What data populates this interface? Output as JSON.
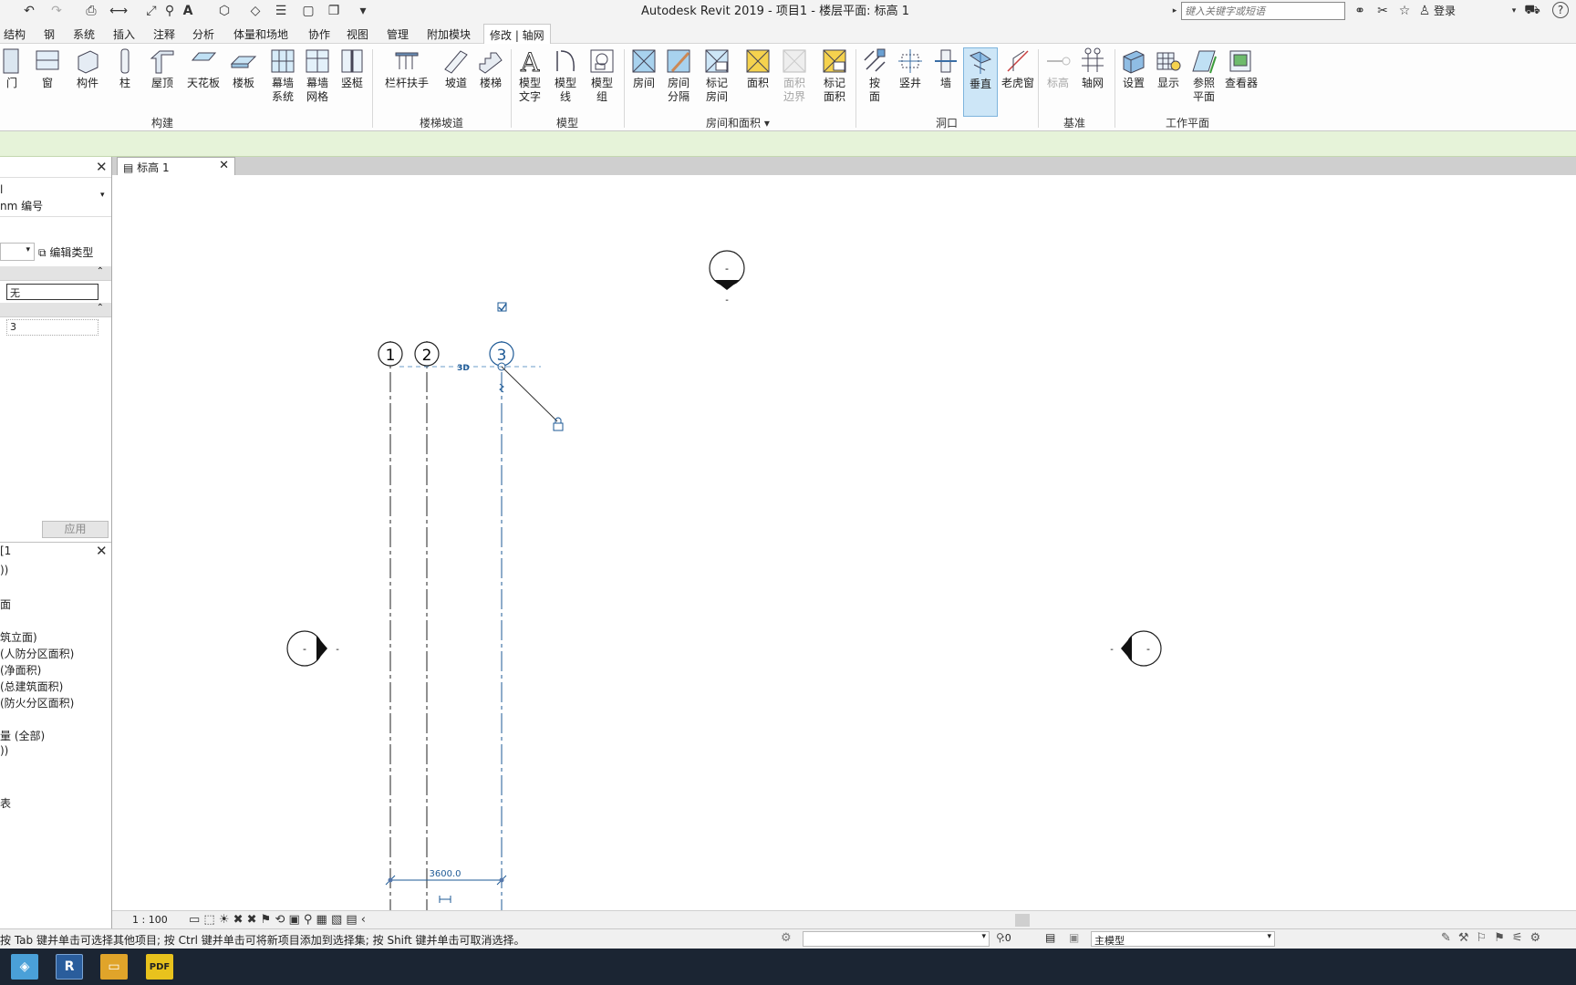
{
  "app": {
    "title": "Autodesk Revit 2019 - 项目1 - 楼层平面: 标高 1",
    "search_placeholder": "键入关键字或短语",
    "login": "登录"
  },
  "menu": {
    "tabs": [
      "结构",
      "钢",
      "系统",
      "插入",
      "注释",
      "分析",
      "体量和场地",
      "协作",
      "视图",
      "管理",
      "附加模块",
      "修改 | 轴网"
    ],
    "active_index": 11
  },
  "ribbon": {
    "buttons": {
      "door": "门",
      "window": "窗",
      "component": "构件",
      "column": "柱",
      "roof": "屋顶",
      "ceiling": "天花板",
      "floor": "楼板",
      "curtain_system_1": "幕墙",
      "curtain_system_2": "系统",
      "curtain_grid_1": "幕墙",
      "curtain_grid_2": "网格",
      "mullion": "竖梃",
      "railing": "栏杆扶手",
      "ramp": "坡道",
      "stair": "楼梯",
      "model_text_1": "模型",
      "model_text_2": "文字",
      "model_line_1": "模型",
      "model_line_2": "线",
      "model_group_1": "模型",
      "model_group_2": "组",
      "room": "房间",
      "room_sep_1": "房间",
      "room_sep_2": "分隔",
      "tag_room_1": "标记",
      "tag_room_2": "房间",
      "area": "面积",
      "area_boundary_1": "面积",
      "area_boundary_2": "边界",
      "tag_area_1": "标记",
      "tag_area_2": "面积",
      "by_face_1": "按",
      "by_face_2": "面",
      "shaft": "竖井",
      "wall_opening": "墙",
      "vertical": "垂直",
      "dormer": "老虎窗",
      "level": "标高",
      "grid": "轴网",
      "set": "设置",
      "show": "显示",
      "ref_plane_1": "参照",
      "ref_plane_2": "平面",
      "viewer": "查看器"
    },
    "panels": {
      "build": "构建",
      "circulation": "楼梯坡道",
      "model": "模型",
      "room_area": "房间和面积",
      "opening": "洞口",
      "datum": "基准",
      "work_plane": "工作平面"
    }
  },
  "properties": {
    "type_line1": "l",
    "type_line2": "nm 编号",
    "edit_type": "编辑类型",
    "field1_value": "无",
    "field2_value": "3",
    "apply": "应用"
  },
  "project_browser": {
    "title": "[1",
    "items": [
      "))",
      "面",
      "筑立面)",
      "(人防分区面积)",
      "(净面积)",
      "(总建筑面积)",
      "(防火分区面积)",
      "量 (全部)",
      "))",
      "表"
    ]
  },
  "view": {
    "tab_title": "标高 1",
    "grid_labels": [
      "1",
      "2",
      "3"
    ],
    "dimension": "3600.0",
    "tag_3d": "3D",
    "elevation_mark": "-",
    "scale": "1 : 100"
  },
  "status": {
    "message": "按 Tab 键并单击可选择其他项目; 按 Ctrl 键并单击可将新项目添加到选择集; 按 Shift 键并单击可取消选择。",
    "selection_count": ":0",
    "model": "主模型"
  },
  "colors": {
    "accent": "#1e5a96",
    "options_bar": "#e6f3d9",
    "selected_button": "#cde6f7",
    "taskbar": "#1b2533"
  }
}
